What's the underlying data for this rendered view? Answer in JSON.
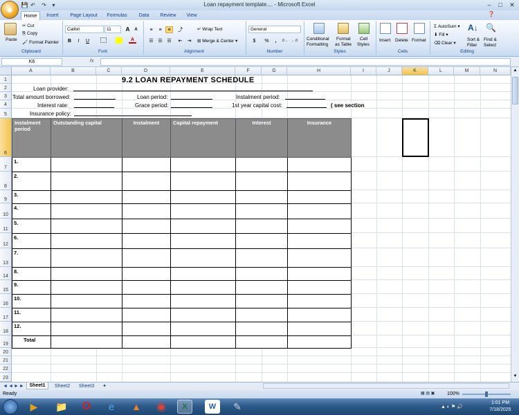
{
  "window": {
    "title": "Loan repayment template.... - Microsoft Excel",
    "minimize": "–",
    "maximize": "□",
    "close": "✕"
  },
  "qat": {
    "save": "💾",
    "undo": "↶",
    "redo": "↷",
    "customize": "▾"
  },
  "tabs": [
    "Home",
    "Insert",
    "Page Layout",
    "Formulas",
    "Data",
    "Review",
    "View"
  ],
  "ribbon": {
    "clipboard": {
      "paste": "Paste",
      "cut": "Cut",
      "copy": "Copy",
      "format_painter": "Format Painter",
      "label": "Clipboard"
    },
    "font": {
      "name": "Calibri",
      "size": "11",
      "grow": "A",
      "shrink": "A",
      "bold": "B",
      "italic": "I",
      "underline": "U",
      "label": "Font"
    },
    "alignment": {
      "wrap_text": "Wrap Text",
      "merge_center": "Merge & Center",
      "label": "Alignment"
    },
    "number": {
      "format": "General",
      "currency": "$",
      "percent": "%",
      "comma": ",",
      "label": "Number"
    },
    "styles": {
      "conditional": "Conditional",
      "conditional2": "Formatting",
      "format_table": "Format",
      "format_table2": "as Table",
      "cell_styles": "Cell",
      "cell_styles2": "Styles",
      "label": "Styles"
    },
    "cells": {
      "insert": "Insert",
      "delete": "Delete",
      "format": "Format",
      "label": "Cells"
    },
    "editing": {
      "autosum": "AutoSum",
      "fill": "Fill",
      "clear": "Clear",
      "sort": "Sort &",
      "sort2": "Filter",
      "find": "Find &",
      "find2": "Select",
      "label": "Editing"
    }
  },
  "formula_bar": {
    "name_box": "K6",
    "fx": "fx",
    "value": ""
  },
  "columns": [
    "A",
    "B",
    "C",
    "D",
    "E",
    "F",
    "G",
    "H",
    "I",
    "J",
    "K",
    "L",
    "M",
    "N"
  ],
  "rows": [
    "1",
    "2",
    "3",
    "4",
    "5",
    "6",
    "7",
    "8",
    "9",
    "10",
    "11",
    "12",
    "13",
    "14",
    "15",
    "16",
    "17",
    "18",
    "19",
    "20",
    "21",
    "22",
    "23"
  ],
  "sheet": {
    "title": "9.2 LOAN REPAYMENT SCHEDULE",
    "loan_provider": "Loan provider:",
    "total_borrowed": "Total amount borrowed:",
    "loan_period": "Loan period:",
    "instalment_period": "Instalment period:",
    "interest_rate": "Interest rate:",
    "grace_period": "Grace period:",
    "capital_cost": "1st year capital cost:",
    "see_section": "( see section",
    "insurance_policy": "Insurance policy:"
  },
  "table": {
    "headers": [
      "Instalment period",
      "Outstanding capital",
      "Instalment",
      "Capital repayment",
      "Interest",
      "Insurance"
    ],
    "rows": [
      "1.",
      "2.",
      "3.",
      "4.",
      "5.",
      "6.",
      "7.",
      "8.",
      "9.",
      "10.",
      "11.",
      "12.",
      "Total"
    ]
  },
  "sheet_tabs": [
    "Sheet1",
    "Sheet2",
    "Sheet3"
  ],
  "status": {
    "ready": "Ready",
    "zoom": "100%"
  },
  "taskbar": {
    "time": "1:01 PM",
    "date": "7/18/2025"
  }
}
